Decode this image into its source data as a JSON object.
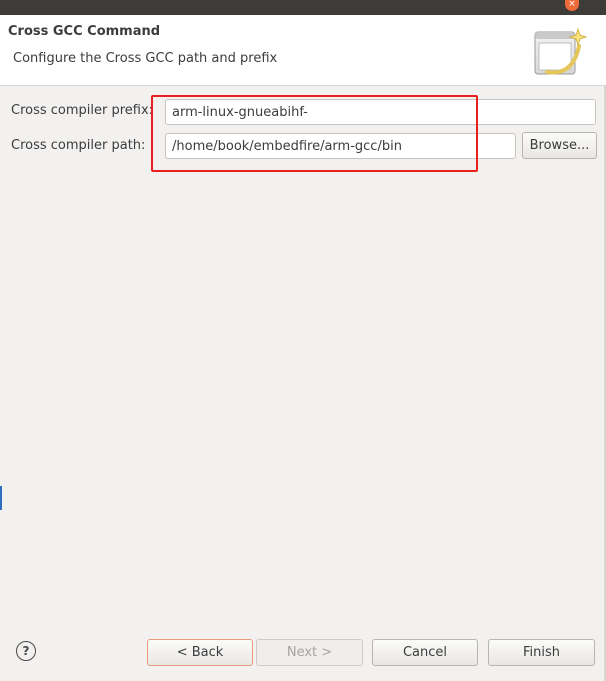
{
  "titlebar": {
    "close_glyph": "×"
  },
  "header": {
    "title": "Cross GCC Command",
    "description": "Configure the Cross GCC path and prefix",
    "image_icon": "wizard-banner-icon"
  },
  "form": {
    "prefix_label": "Cross compiler prefix:",
    "prefix_value": "arm-linux-gnueabihf-",
    "path_label": "Cross compiler path:",
    "path_value": "/home/book/embedfire/arm-gcc/bin",
    "browse_label": "Browse..."
  },
  "annotation": {
    "color": "#e8211e"
  },
  "footer": {
    "help_glyph": "?",
    "back_label": "< Back",
    "next_label": "Next >",
    "cancel_label": "Cancel",
    "finish_label": "Finish"
  }
}
